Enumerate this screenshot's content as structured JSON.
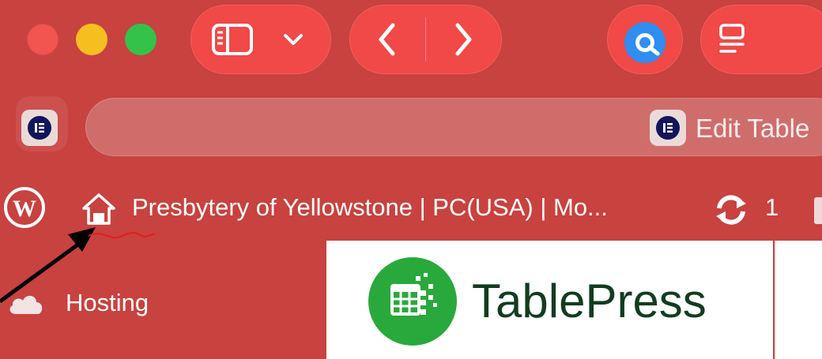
{
  "browser": {
    "tab_title": "Edit Table",
    "icons": {
      "sidebar_toggle": "sidebar-icon",
      "sidebar_menu": "chevron-down-icon",
      "back": "chevron-left-icon",
      "forward": "chevron-right-icon",
      "extension": "circle-app-icon",
      "reader": "reader-icon",
      "elementor": "elementor-icon"
    }
  },
  "admin_bar": {
    "site_title": "Presbytery of Yellowstone | PC(USA) | Mo...",
    "updates_count": "1",
    "icons": {
      "wp": "wordpress-icon",
      "home": "home-icon",
      "updates": "refresh-icon"
    }
  },
  "sidebar": {
    "hosting_label": "Hosting"
  },
  "content": {
    "plugin_name": "TablePress"
  },
  "colors": {
    "toolbar_bg": "#c8423f",
    "pill_bg": "#f14848",
    "tablepress_green": "#29a93b",
    "tablepress_text": "#123c20",
    "elementor_navy": "#12155a"
  }
}
